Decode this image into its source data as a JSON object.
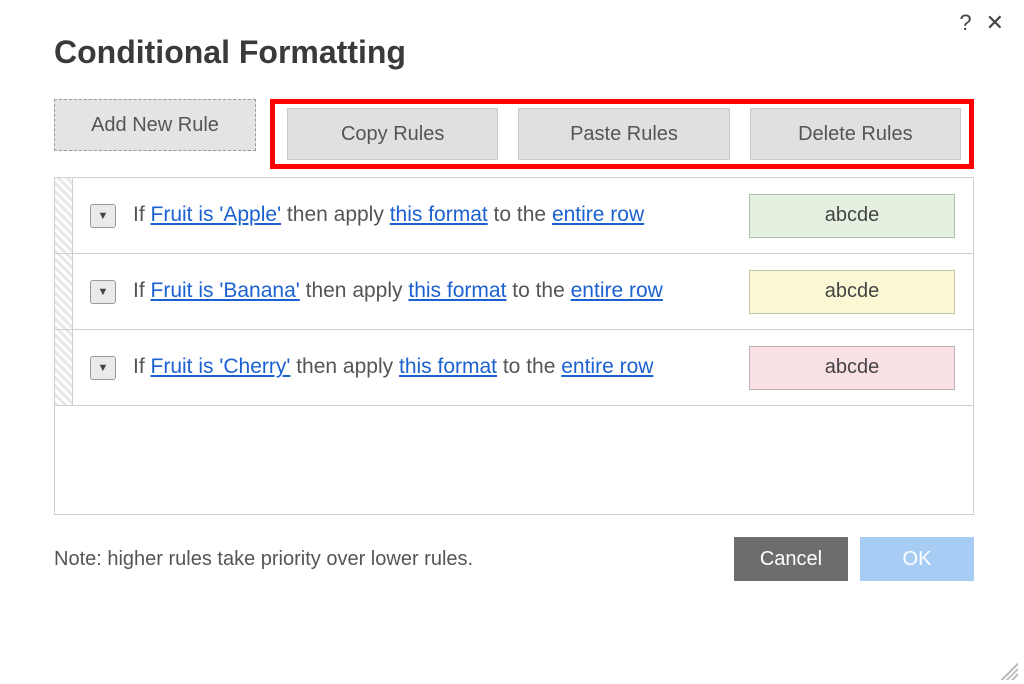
{
  "dialog": {
    "title": "Conditional Formatting"
  },
  "topIcons": {
    "help": "?",
    "close": "✕"
  },
  "toolbar": {
    "add": "Add New Rule",
    "copy": "Copy Rules",
    "paste": "Paste Rules",
    "delete": "Delete Rules"
  },
  "ruleText": {
    "if": "If ",
    "thenApply": " then apply ",
    "thisFormat": "this format",
    "toThe": " to the ",
    "entireRow": "entire row"
  },
  "rules": [
    {
      "condition": "Fruit is 'Apple'",
      "sample": "abcde",
      "swatchClass": "sample-green"
    },
    {
      "condition": "Fruit is 'Banana'",
      "sample": "abcde",
      "swatchClass": "sample-yellow"
    },
    {
      "condition": "Fruit is 'Cherry'",
      "sample": "abcde",
      "swatchClass": "sample-pink"
    }
  ],
  "footer": {
    "note": "Note: higher rules take priority over lower rules.",
    "cancel": "Cancel",
    "ok": "OK"
  },
  "glyphs": {
    "caretDown": "▼"
  }
}
